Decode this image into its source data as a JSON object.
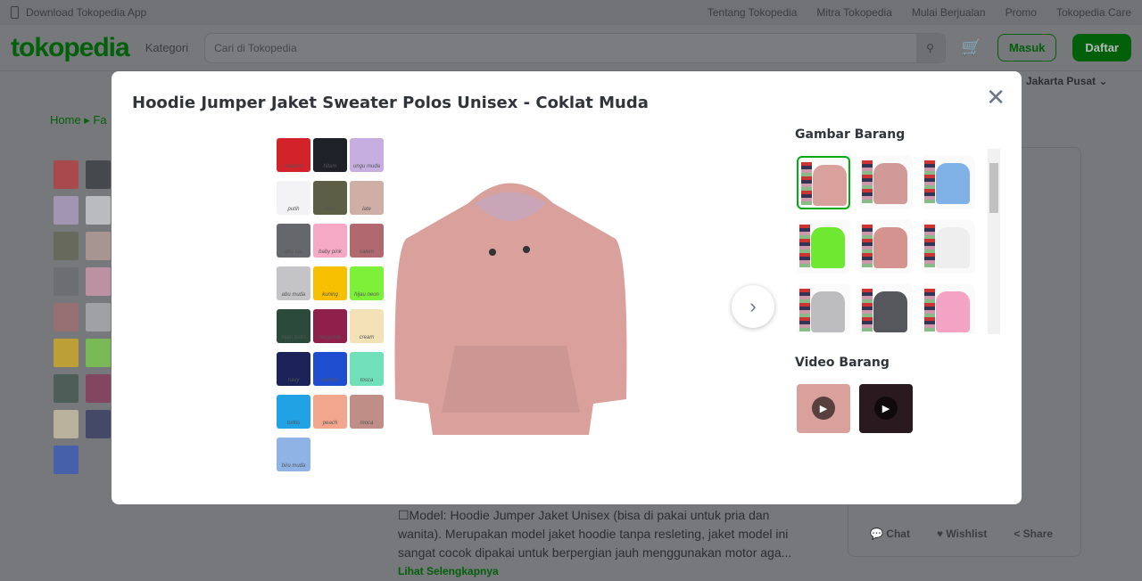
{
  "topbar": {
    "download": "Download Tokopedia App",
    "links": [
      "Tentang Tokopedia",
      "Mitra Tokopedia",
      "Mulai Berjualan",
      "Promo",
      "Tokopedia Care"
    ]
  },
  "header": {
    "logo": "tokopedia",
    "kategori": "Kategori",
    "search_placeholder": "Cari di Tokopedia",
    "masuk": "Masuk",
    "daftar": "Daftar",
    "location": "Jakarta Pusat"
  },
  "breadcrumb": {
    "home": "Home"
  },
  "description": {
    "text": "☐Model: Hoodie Jumper Jaket Unisex (bisa di pakai untuk pria dan wanita). Merupakan model jaket hoodie tanpa resleting, jaket model ini sangat cocok dipakai untuk berpergian jauh menggunakan motor aga...",
    "more": "Lihat Selengkapnya"
  },
  "actions": {
    "chat": "Chat",
    "wishlist": "Wishlist",
    "share": "Share"
  },
  "modal": {
    "title": "Hoodie Jumper Jaket Sweater Polos Unisex - Coklat Muda",
    "images_heading": "Gambar Barang",
    "videos_heading": "Video Barang",
    "swatches": [
      {
        "label": "maroon",
        "color": "#d2232a"
      },
      {
        "label": "hitam",
        "color": "#1e2128"
      },
      {
        "label": "ungu muda",
        "color": "#c6aee0"
      },
      {
        "label": "putih",
        "color": "#f3f3f6"
      },
      {
        "label": "army",
        "color": "#5c5e45"
      },
      {
        "label": "late",
        "color": "#cfaea6"
      },
      {
        "label": "abu tua",
        "color": "#66676c"
      },
      {
        "label": "baby pink",
        "color": "#f6a9c4"
      },
      {
        "label": "salem",
        "color": "#b1686e"
      },
      {
        "label": "abu muda",
        "color": "#c4c4c6"
      },
      {
        "label": "kuning",
        "color": "#f6c000"
      },
      {
        "label": "hijau neon",
        "color": "#7df03a"
      },
      {
        "label": "hijau botol",
        "color": "#2b4a3b"
      },
      {
        "label": "burgundy",
        "color": "#8f1f4b"
      },
      {
        "label": "cream",
        "color": "#f3e1b8"
      },
      {
        "label": "navy",
        "color": "#1c2358"
      },
      {
        "label": "benhur",
        "color": "#1f4dd0"
      },
      {
        "label": "tosca",
        "color": "#6fe0b9"
      },
      {
        "label": "turkis",
        "color": "#21a2e4"
      },
      {
        "label": "peach",
        "color": "#f3a68e"
      },
      {
        "label": "moca",
        "color": "#bf8e87"
      },
      {
        "label": "biru muda",
        "color": "#8fb3e4"
      }
    ],
    "thumbnails": [
      {
        "color": "#d9a09c",
        "selected": true
      },
      {
        "color": "#d09a98",
        "selected": false
      },
      {
        "color": "#7fb0e6",
        "selected": false
      },
      {
        "color": "#6fe832",
        "selected": false
      },
      {
        "color": "#d4938f",
        "selected": false
      },
      {
        "color": "#eeeeee",
        "selected": false
      },
      {
        "color": "#bdbdbf",
        "selected": false
      },
      {
        "color": "#55575d",
        "selected": false
      },
      {
        "color": "#f3a3c3",
        "selected": false
      }
    ],
    "videos": [
      {
        "color": "#d9a09c"
      },
      {
        "color": "#2a1a20"
      }
    ],
    "main_color": "#d9a09c"
  },
  "colors": {
    "accent": "#03ac0e"
  }
}
